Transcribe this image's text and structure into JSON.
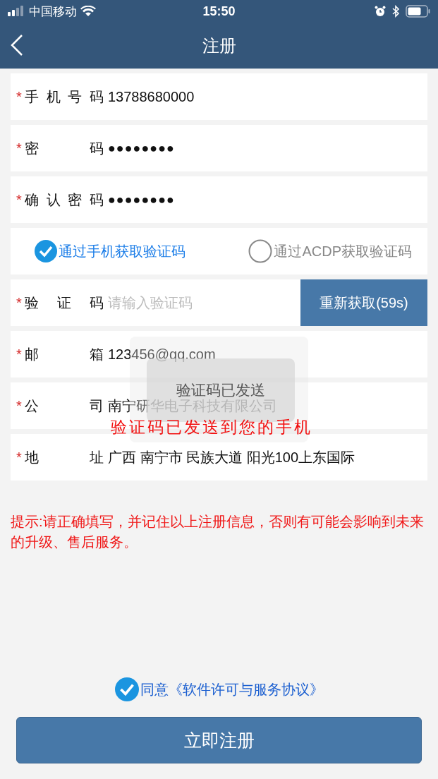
{
  "status_bar": {
    "carrier": "中国移动",
    "time": "15:50"
  },
  "nav": {
    "title": "注册"
  },
  "fields": [
    {
      "kind": "text",
      "required": true,
      "label": "手机号码",
      "value": "13788680000"
    },
    {
      "kind": "password",
      "required": true,
      "label": "密码",
      "value": "●●●●●●●●"
    },
    {
      "kind": "password",
      "required": true,
      "label": "确认密码",
      "value": "●●●●●●●●"
    },
    {
      "kind": "methods",
      "options": [
        {
          "label": "通过手机获取验证码",
          "selected": true
        },
        {
          "label": "通过ACDP获取验证码",
          "selected": false
        }
      ]
    },
    {
      "kind": "code",
      "required": true,
      "label": "验证码",
      "placeholder": "请输入验证码",
      "button": "重新获取(59s)"
    },
    {
      "kind": "text",
      "required": true,
      "label": "邮箱",
      "value": "123456@qq.com"
    },
    {
      "kind": "text",
      "required": true,
      "label": "公司",
      "value": "南宁研华电子科技有限公司"
    },
    {
      "kind": "text",
      "required": true,
      "label": "地址",
      "value": "广西 南宁市 民族大道 阳光100上东国际"
    }
  ],
  "required_mark": "*",
  "hint": "提示:请正确填写，并记住以上注册信息，否则有可能会影响到未来的升级、售后服务。",
  "toast": "验证码已发送",
  "annotation": "验证码已发送到您的手机",
  "agreement": {
    "checked": true,
    "text": "同意《软件许可与服务协议》"
  },
  "submit": "立即注册"
}
